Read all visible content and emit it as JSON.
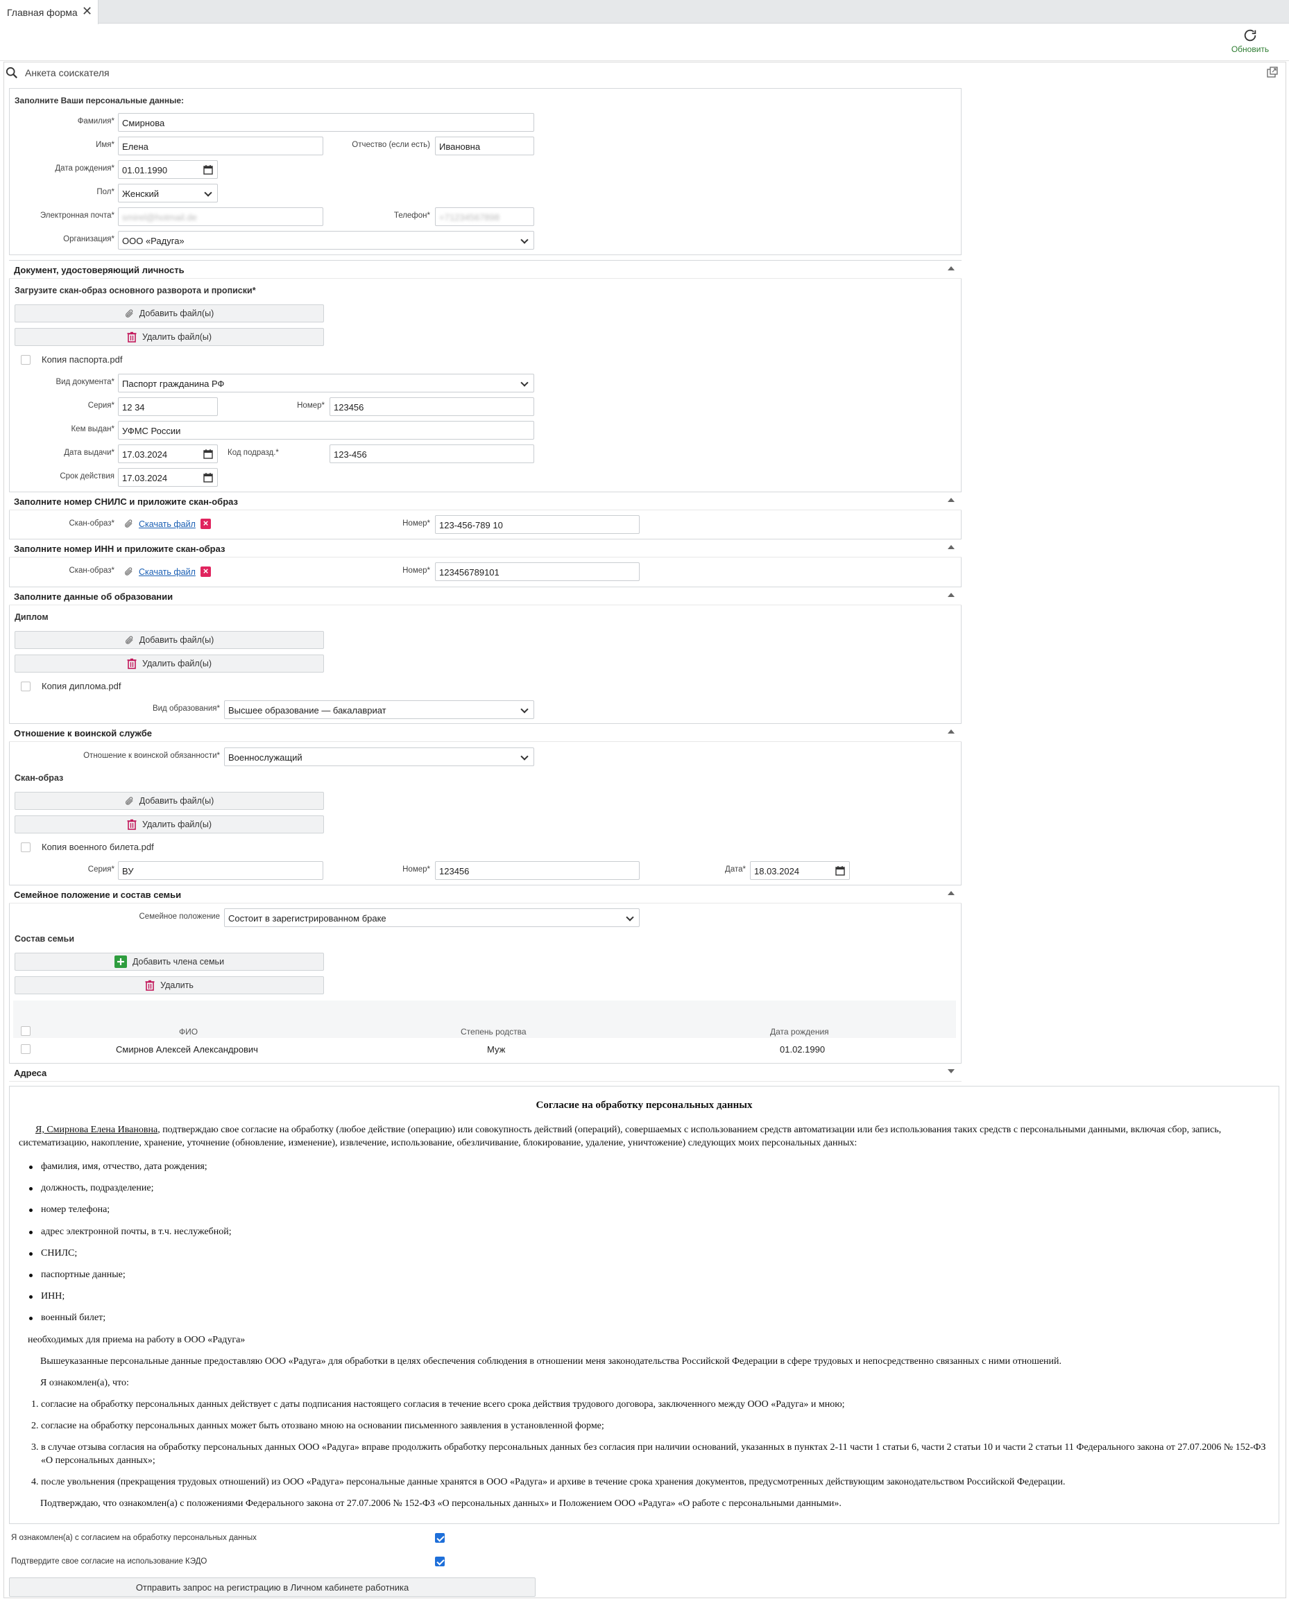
{
  "tab": {
    "title": "Главная форма"
  },
  "toolbar": {
    "refresh_label": "Обновить"
  },
  "form_title": "Анкета соискателя",
  "personal": {
    "title": "Заполните Ваши персональные данные:",
    "last_name_label": "Фамилия*",
    "last_name": "Смирнова",
    "first_name_label": "Имя*",
    "first_name": "Елена",
    "patronymic_label": "Отчество (если есть)",
    "patronymic": "Ивановна",
    "birth_label": "Дата рождения*",
    "birth": "01.01.1990",
    "gender_label": "Пол*",
    "gender": "Женский",
    "email_label": "Электронная почта*",
    "email": "smirel@hotmail.de",
    "phone_label": "Телефон*",
    "phone": "+71234567898",
    "org_label": "Организация*",
    "org": "ООО «Радуга»"
  },
  "id_doc": {
    "title": "Документ, удостоверяющий личность",
    "upload_label": "Загрузите скан-образ основного разворота и прописки*",
    "add_files": "Добавить файл(ы)",
    "delete_files": "Удалить файл(ы)",
    "file_name": "Копия паспорта.pdf",
    "doc_type_label": "Вид документа*",
    "doc_type": "Паспорт гражданина РФ",
    "series_label": "Серия*",
    "series": "12 34",
    "number_label": "Номер*",
    "number": "123456",
    "issued_by_label": "Кем выдан*",
    "issued_by": "УФМС России",
    "issue_date_label": "Дата выдачи*",
    "issue_date": "17.03.2024",
    "code_label": "Код подразд.*",
    "code": "123-456",
    "validity_label": "Срок действия",
    "validity": "17.03.2024"
  },
  "snils": {
    "title": "Заполните номер СНИЛС и приложите скан-образ",
    "scan_label": "Скан-образ*",
    "download": "Скачать файл",
    "number_label": "Номер*",
    "number": "123-456-789 10"
  },
  "inn": {
    "title": "Заполните номер ИНН и приложите скан-образ",
    "scan_label": "Скан-образ*",
    "download": "Скачать файл",
    "number_label": "Номер*",
    "number": "123456789101"
  },
  "education": {
    "title": "Заполните данные об образовании",
    "diploma_label": "Диплом",
    "add_files": "Добавить файл(ы)",
    "delete_files": "Удалить файл(ы)",
    "file_name": "Копия диплома.pdf",
    "type_label": "Вид образования*",
    "type": "Высшее образование — бакалавриат"
  },
  "military": {
    "title": "Отношение к воинской службе",
    "relation_label": "Отношение к воинской обязанности*",
    "relation": "Военнослужащий",
    "scan_label": "Скан-образ",
    "add_files": "Добавить файл(ы)",
    "delete_files": "Удалить файл(ы)",
    "file_name": "Копия военного билета.pdf",
    "series_label": "Серия*",
    "series": "ВУ",
    "number_label": "Номер*",
    "number": "123456",
    "date_label": "Дата*",
    "date": "18.03.2024"
  },
  "family": {
    "title": "Семейное положение и состав семьи",
    "status_label": "Семейное положение",
    "status": "Состоит в зарегистрированном браке",
    "members_label": "Состав семьи",
    "add_member": "Добавить члена семьи",
    "delete": "Удалить",
    "columns": [
      "ФИО",
      "Степень родства",
      "Дата рождения"
    ],
    "rows": [
      [
        "Смирнов Алексей Александрович",
        "Муж",
        "01.02.1990"
      ]
    ]
  },
  "addresses": {
    "title": "Адреса"
  },
  "consent": {
    "title": "Согласие на обработку персональных данных",
    "intro_name": "Я, Смирнова Елена Ивановна",
    "intro_rest": ", подтверждаю свое согласие на обработку (любое действие (операцию) или совокупность действий (операций), совершаемых с использованием средств автоматизации или без использования таких средств с персональными данными, включая сбор, запись, систематизацию, накопление, хранение, уточнение (обновление, изменение), извлечение, использование, обезличивание, блокирование, удаление, уничтожение) следующих моих персональных данных:",
    "items": [
      "фамилия, имя, отчество, дата рождения;",
      "должность, подразделение;",
      "номер телефона;",
      "адрес электронной почты, в т.ч. неслужебной;",
      "СНИЛС;",
      "паспортные данные;",
      "ИНН;",
      "военный билет;"
    ],
    "purpose": "необходимых для приема на работу в ООО «Радуга»",
    "para2": "Вышеуказанные персональные данные предоставляю ООО «Радуга» для обработки в целях обеспечения соблюдения в отношении меня законодательства Российской Федерации в сфере трудовых и непосредственно связанных с ними отношений.",
    "aware": "Я ознакомлен(а), что:",
    "n1": "согласие на обработку персональных данных действует с даты подписания настоящего согласия в течение всего срока действия трудового договора, заключенного между ООО «Радуга» и мною;",
    "n2": "согласие на обработку персональных данных может быть отозвано мною на основании письменного заявления в установленной форме;",
    "n3_a": "в случае отзыва согласия на обработку персональных данных ООО «Радуга» вправе продолжить обработку персональных данных без согласия при наличии оснований, указанных в ",
    "n3_link1": "пунктах 2-11 части 1 статьи 6",
    "n3_b": ", ",
    "n3_link2": "части 2",
    "n3_c": " статьи 10 и ",
    "n3_link3": "части 2 статьи 11",
    "n3_d": " Федерального закона от 27.07.2006 № 152-ФЗ «О персональных данных»;",
    "n4": "после увольнения (прекращения трудовых отношений) из ООО «Радуга» персональные данные хранятся в ООО «Радуга» и архиве в течение срока хранения документов, предусмотренных действующим законодательством Российской Федерации.",
    "final": "Подтверждаю, что ознакомлен(а) с положениями Федерального закона от 27.07.2006 № 152-ФЗ «О персональных данных» и Положением ООО «Радуга» «О работе с персональными данными»."
  },
  "ack1_label": "Я ознакомлен(а) с согласием на обработку персональных данных",
  "ack2_label": "Подтвердите свое согласие на использование КЭДО",
  "submit_label": "Отправить запрос на регистрацию в Личном кабинете работника"
}
